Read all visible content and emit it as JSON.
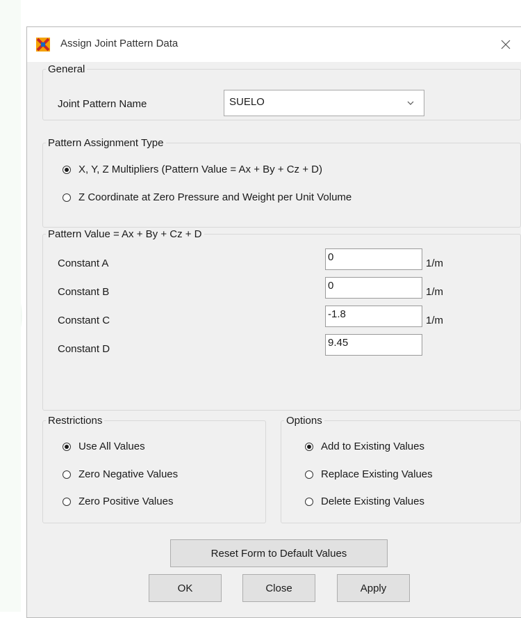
{
  "window": {
    "title": "Assign Joint Pattern Data",
    "app_icon": "sap-app-icon",
    "close_icon": "close-icon"
  },
  "general": {
    "legend": "General",
    "pattern_name_label": "Joint Pattern Name",
    "pattern_name_value": "SUELO"
  },
  "assignment_type": {
    "legend": "Pattern Assignment Type",
    "options": [
      {
        "label": "X, Y, Z Multipliers  (Pattern Value = Ax + By + Cz + D)",
        "selected": true
      },
      {
        "label": "Z Coordinate at Zero Pressure and Weight per Unit Volume",
        "selected": false
      }
    ]
  },
  "pattern_value": {
    "legend": "Pattern Value = Ax + By + Cz + D",
    "constants": [
      {
        "label": "Constant A",
        "value": "0",
        "unit": "1/m"
      },
      {
        "label": "Constant B",
        "value": "0",
        "unit": "1/m"
      },
      {
        "label": "Constant C",
        "value": "-1.8",
        "unit": "1/m"
      },
      {
        "label": "Constant D",
        "value": "9.45",
        "unit": ""
      }
    ]
  },
  "restrictions": {
    "legend": "Restrictions",
    "options": [
      {
        "label": "Use All Values",
        "selected": true
      },
      {
        "label": "Zero Negative Values",
        "selected": false
      },
      {
        "label": "Zero Positive Values",
        "selected": false
      }
    ]
  },
  "options": {
    "legend": "Options",
    "options": [
      {
        "label": "Add to Existing Values",
        "selected": true
      },
      {
        "label": "Replace Existing Values",
        "selected": false
      },
      {
        "label": "Delete Existing Values",
        "selected": false
      }
    ]
  },
  "buttons": {
    "reset": "Reset Form to Default Values",
    "ok": "OK",
    "close": "Close",
    "apply": "Apply"
  }
}
